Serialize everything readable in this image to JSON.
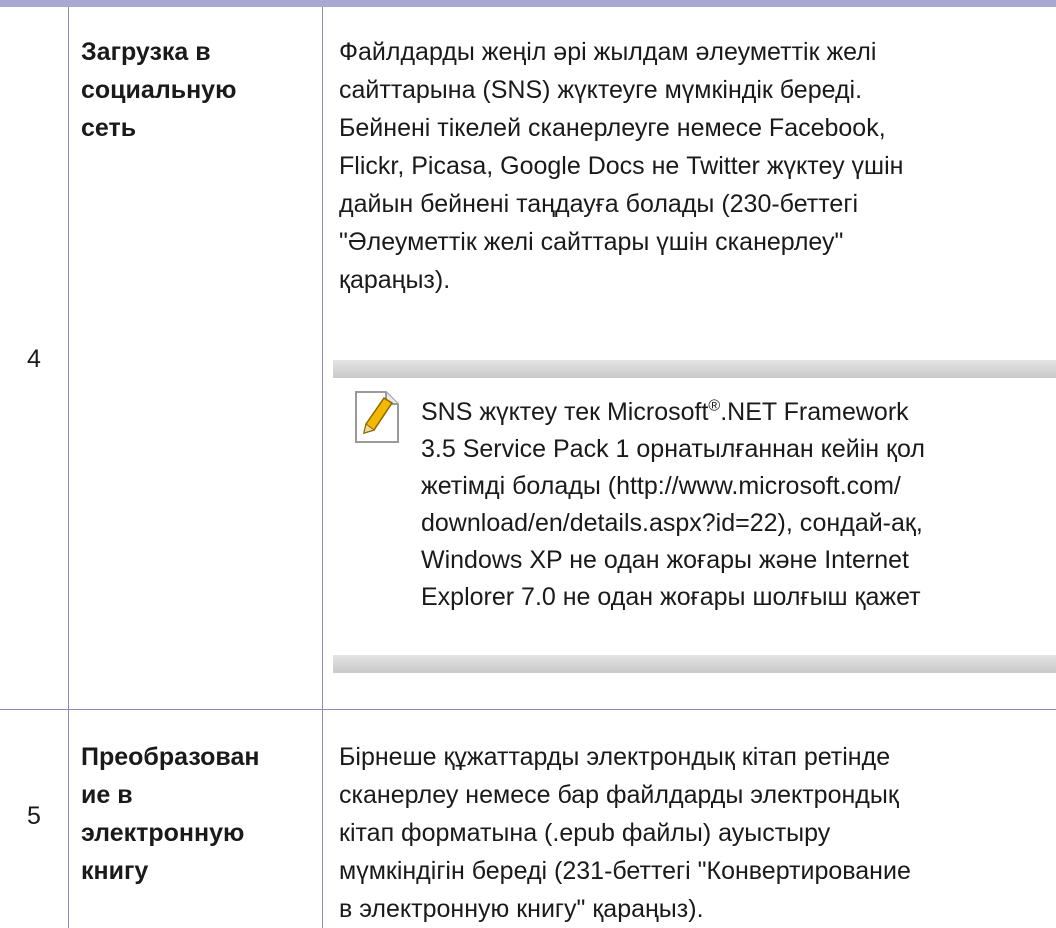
{
  "rows": [
    {
      "num": "4",
      "feature_lines": [
        "Загрузка в",
        "социальную",
        "сеть"
      ],
      "desc_lines": [
        "Файлдарды жеңіл әрі жылдам әлеуметтік желі",
        "сайттарына (SNS) жүктеуге мүмкіндік береді.",
        "Бейнені тікелей сканерлеуге немесе Facebook,",
        "Flickr, Picasa, Google Docs не Twitter жүктеу үшін",
        "дайын бейнені таңдауға болады (230-беттегі",
        "\"Әлеуметтік желі сайттары үшін сканерлеу\"",
        "қараңыз)."
      ],
      "note": {
        "icon": "note-pencil-icon",
        "line1_before": "SNS жүктеу тек Microsoft",
        "line1_sup": "®",
        "line1_after": ".NET Framework",
        "lines": [
          "3.5 Service Pack 1 орнатылғаннан кейін қол",
          "жетімді болады (http://www.microsoft.com/",
          "download/en/details.aspx?id=22), сондай-ақ,",
          "Windows XP не одан жоғары және Internet",
          "Explorer 7.0 не одан жоғары шолғыш қажет"
        ]
      }
    },
    {
      "num": "5",
      "feature_lines": [
        "Преобразован",
        "ие в",
        "электронную",
        "книгу"
      ],
      "desc_lines": [
        "Бірнеше құжаттарды электрондық кітап ретінде",
        "сканерлеу немесе бар файлдарды электрондық",
        "кітап форматына (.epub файлы) ауыстыру",
        "мүмкіндігін береді (231-беттегі \"Конвертирование",
        "в электронную книгу\" қараңыз)."
      ]
    }
  ]
}
